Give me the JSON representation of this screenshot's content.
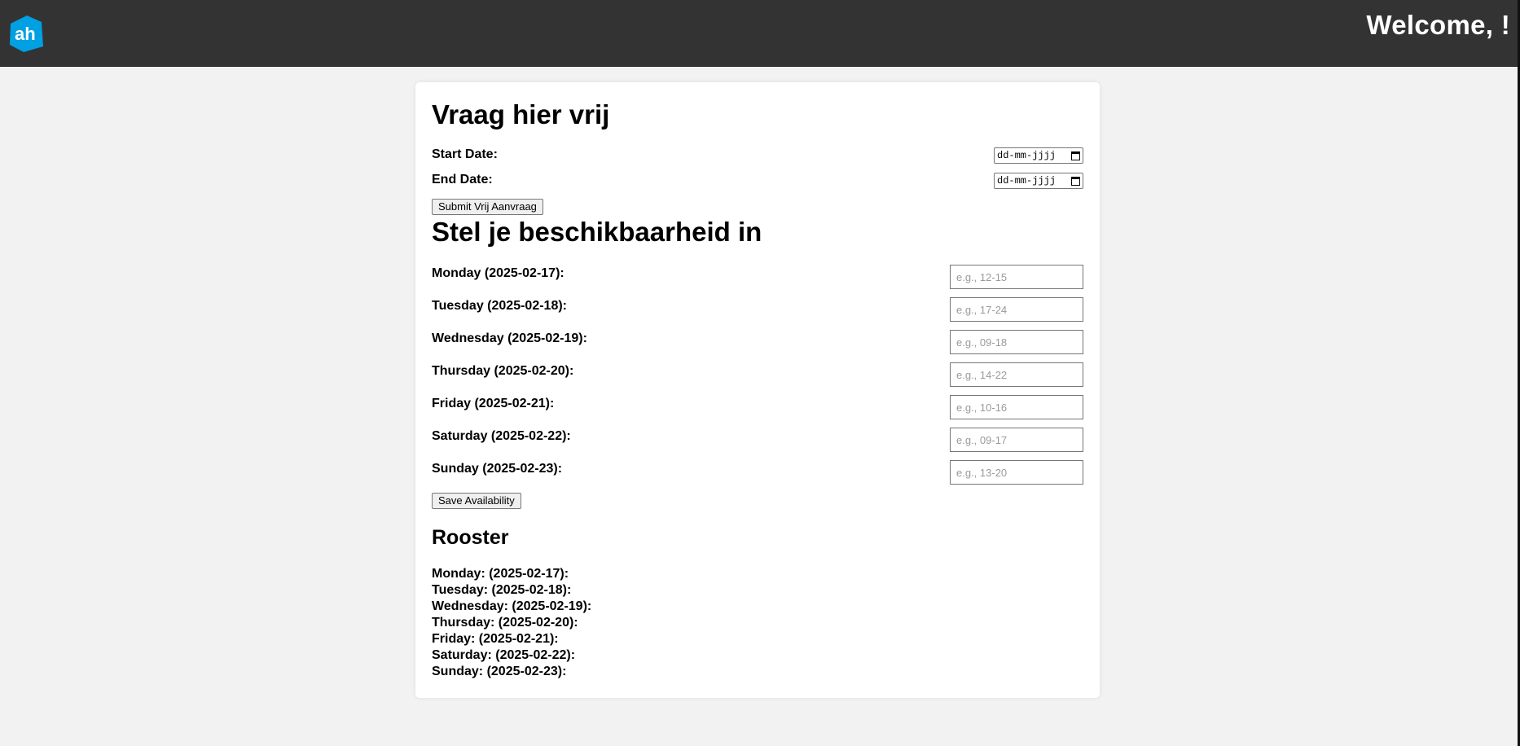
{
  "header": {
    "logo_alt": "ah",
    "welcome": "Welcome, !"
  },
  "vrij": {
    "title": "Vraag hier vrij",
    "start_label": "Start Date:",
    "end_label": "End Date:",
    "start_value": "dd-mm-jjjj",
    "end_value": "dd-mm-jjjj",
    "submit_label": "Submit Vrij Aanvraag"
  },
  "availability": {
    "title": "Stel je beschikbaarheid in",
    "days": [
      {
        "label": "Monday (2025-02-17):",
        "placeholder": "e.g., 12-15"
      },
      {
        "label": "Tuesday (2025-02-18):",
        "placeholder": "e.g., 17-24"
      },
      {
        "label": "Wednesday (2025-02-19):",
        "placeholder": "e.g., 09-18"
      },
      {
        "label": "Thursday (2025-02-20):",
        "placeholder": "e.g., 14-22"
      },
      {
        "label": "Friday (2025-02-21):",
        "placeholder": "e.g., 10-16"
      },
      {
        "label": "Saturday (2025-02-22):",
        "placeholder": "e.g., 09-17"
      },
      {
        "label": "Sunday (2025-02-23):",
        "placeholder": "e.g., 13-20"
      }
    ],
    "save_label": "Save Availability"
  },
  "rooster": {
    "title": "Rooster",
    "items": [
      "Monday: (2025-02-17):",
      "Tuesday: (2025-02-18):",
      "Wednesday: (2025-02-19):",
      "Thursday: (2025-02-20):",
      "Friday: (2025-02-21):",
      "Saturday: (2025-02-22):",
      "Sunday: (2025-02-23):"
    ]
  },
  "colors": {
    "header_bg": "#333333",
    "logo_blue": "#00a0e2",
    "page_bg": "#f2f2f2"
  }
}
